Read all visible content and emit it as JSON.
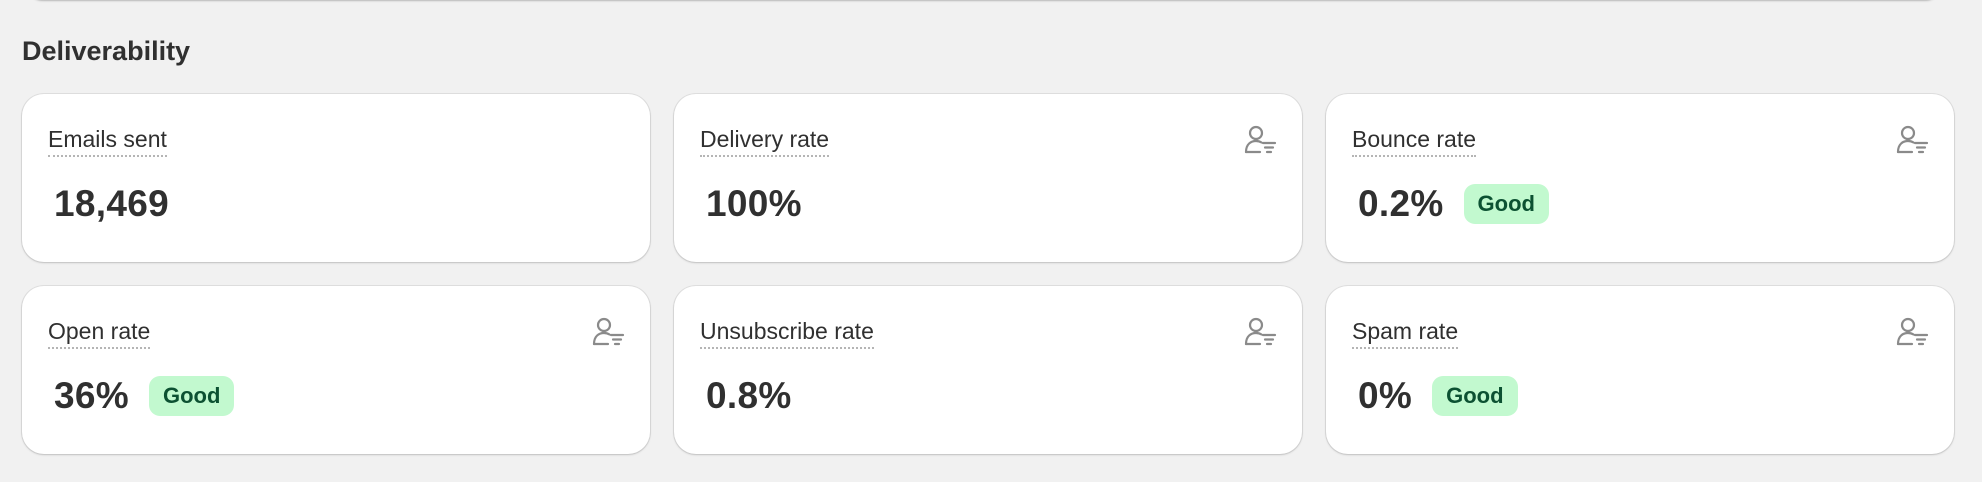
{
  "section": {
    "title": "Deliverability"
  },
  "metrics": [
    {
      "label": "Emails sent",
      "value": "18,469",
      "badge": "",
      "has_segment_icon": false
    },
    {
      "label": "Delivery rate",
      "value": "100%",
      "badge": "",
      "has_segment_icon": true
    },
    {
      "label": "Bounce rate",
      "value": "0.2%",
      "badge": "Good",
      "has_segment_icon": true
    },
    {
      "label": "Open rate",
      "value": "36%",
      "badge": "Good",
      "has_segment_icon": true
    },
    {
      "label": "Unsubscribe rate",
      "value": "0.8%",
      "badge": "",
      "has_segment_icon": true
    },
    {
      "label": "Spam rate",
      "value": "0%",
      "badge": "Good",
      "has_segment_icon": true
    }
  ],
  "icons": {
    "segment": "person-filter-icon"
  },
  "colors": {
    "background": "#f1f1f1",
    "card": "#ffffff",
    "text": "#303030",
    "badge_bg": "#c2f9cf",
    "badge_text": "#0c5132",
    "icon": "#8a8a8a"
  }
}
